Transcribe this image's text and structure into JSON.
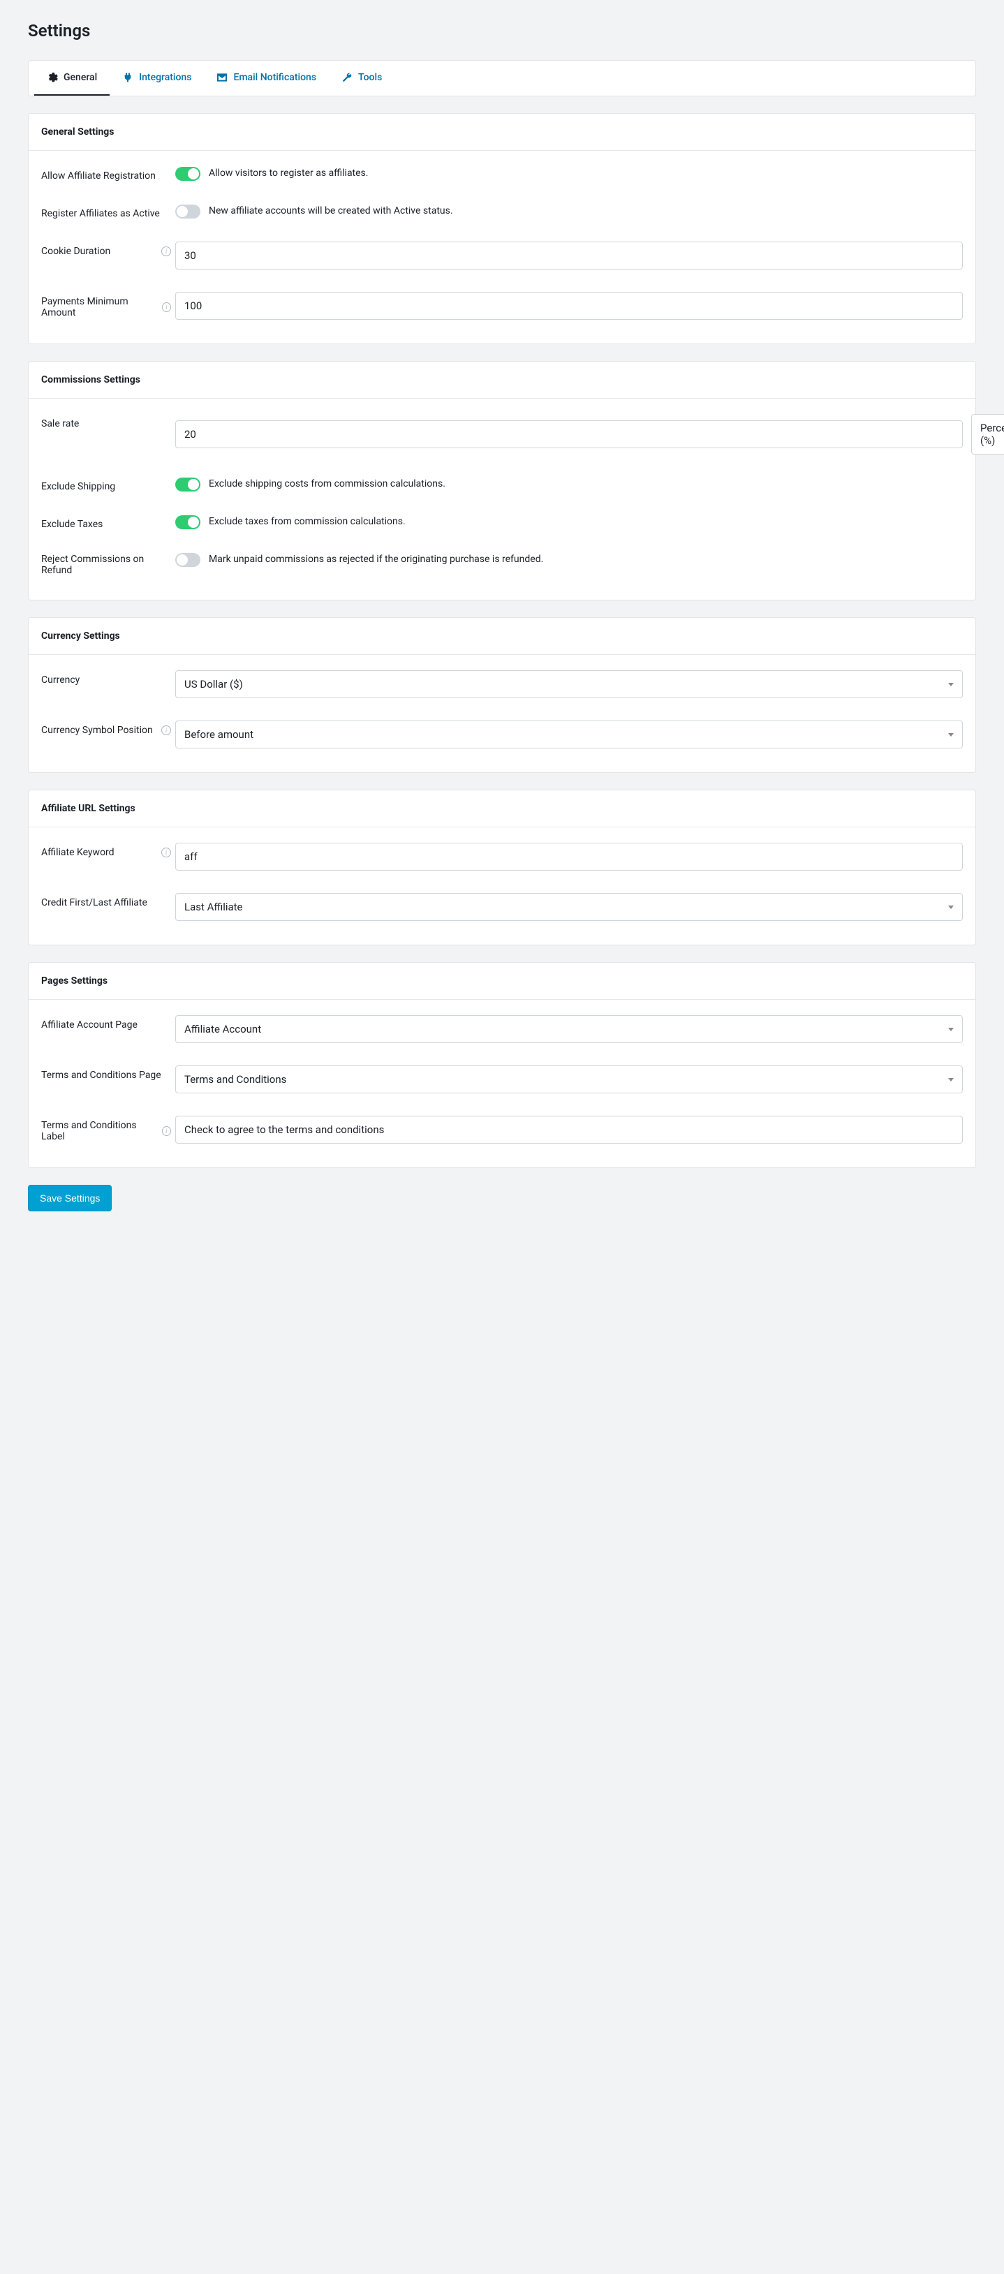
{
  "page_title": "Settings",
  "tabs": {
    "general": "General",
    "integrations": "Integrations",
    "emails": "Email Notifications",
    "tools": "Tools"
  },
  "sections": {
    "general": {
      "title": "General Settings",
      "allow_registration": {
        "label": "Allow Affiliate Registration",
        "help": "Allow visitors to register as affiliates.",
        "on": true
      },
      "register_active": {
        "label": "Register Affiliates as Active",
        "help": "New affiliate accounts will be created with Active status.",
        "on": false
      },
      "cookie_duration": {
        "label": "Cookie Duration",
        "value": "30"
      },
      "min_amount": {
        "label": "Payments Minimum Amount",
        "value": "100"
      }
    },
    "commissions": {
      "title": "Commissions Settings",
      "sale_rate": {
        "label": "Sale rate",
        "value": "20",
        "type": "Percentage (%)"
      },
      "exclude_shipping": {
        "label": "Exclude Shipping",
        "help": "Exclude shipping costs from commission calculations.",
        "on": true
      },
      "exclude_taxes": {
        "label": "Exclude Taxes",
        "help": "Exclude taxes from commission calculations.",
        "on": true
      },
      "reject_refund": {
        "label": "Reject Commissions on Refund",
        "help": "Mark unpaid commissions as rejected if the originating purchase is refunded.",
        "on": false
      }
    },
    "currency": {
      "title": "Currency Settings",
      "currency": {
        "label": "Currency",
        "value": "US Dollar ($)"
      },
      "position": {
        "label": "Currency Symbol Position",
        "value": "Before amount"
      }
    },
    "url": {
      "title": "Affiliate URL Settings",
      "keyword": {
        "label": "Affiliate Keyword",
        "value": "aff"
      },
      "credit": {
        "label": "Credit First/Last Affiliate",
        "value": "Last Affiliate"
      }
    },
    "pages": {
      "title": "Pages Settings",
      "account": {
        "label": "Affiliate Account Page",
        "value": "Affiliate Account"
      },
      "terms_page": {
        "label": "Terms and Conditions Page",
        "value": "Terms and Conditions"
      },
      "terms_label": {
        "label": "Terms and Conditions Label",
        "value": "Check to agree to the terms and conditions"
      }
    }
  },
  "save_button": "Save Settings"
}
